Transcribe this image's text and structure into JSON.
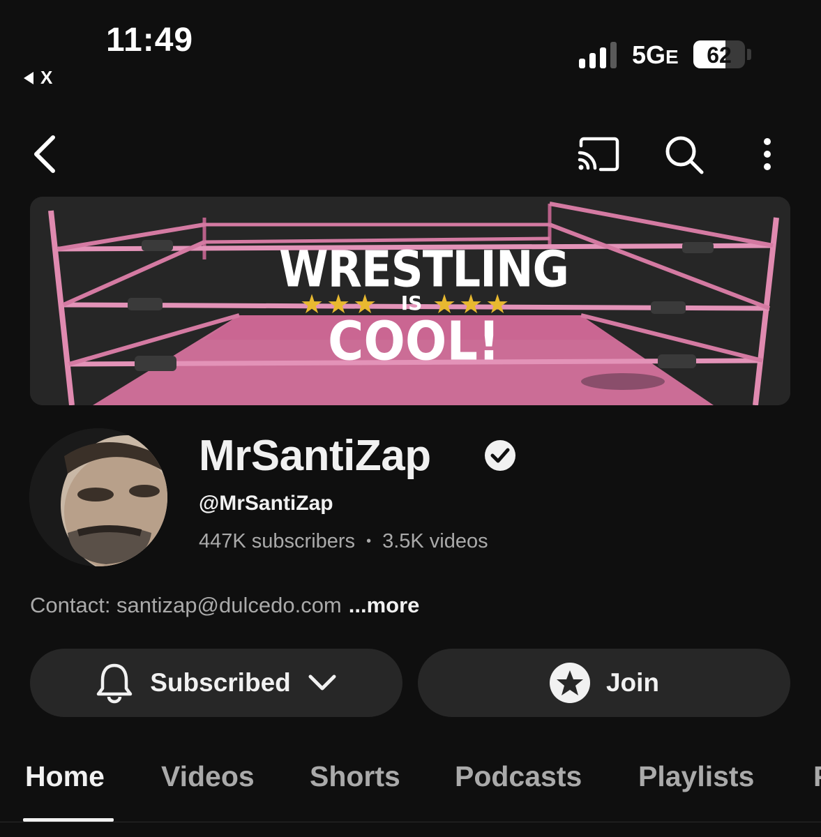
{
  "status_bar": {
    "time": "11:49",
    "back_app": "X",
    "network": "5G",
    "network_suffix": "E",
    "battery_level": "62",
    "battery_fraction": 0.62,
    "signal_bars_active": 3,
    "signal_bars_total": 4
  },
  "app_bar": {
    "icons": [
      "back-arrow-icon",
      "cast-icon",
      "search-icon",
      "more-vertical-icon"
    ]
  },
  "banner": {
    "line1": "WRESTLING",
    "line2": "IS",
    "line3": "COOL!",
    "stars_left": "★★★",
    "stars_right": "★★★",
    "colors": {
      "ring_pink": "#d9739f",
      "background": "#262626",
      "stars": "#e8b930"
    }
  },
  "channel": {
    "name": "MrSantiZap",
    "verified": true,
    "handle": "@MrSantiZap",
    "subscribers": "447K subscribers",
    "separator": "•",
    "videos": "3.5K videos",
    "contact": "Contact: santizap@dulcedo.com",
    "more_label": "...more"
  },
  "actions": {
    "subscribe_label": "Subscribed",
    "join_label": "Join"
  },
  "tabs": [
    {
      "label": "Home",
      "active": true
    },
    {
      "label": "Videos",
      "active": false
    },
    {
      "label": "Shorts",
      "active": false
    },
    {
      "label": "Podcasts",
      "active": false
    },
    {
      "label": "Playlists",
      "active": false
    },
    {
      "label": "P",
      "active": false
    }
  ]
}
